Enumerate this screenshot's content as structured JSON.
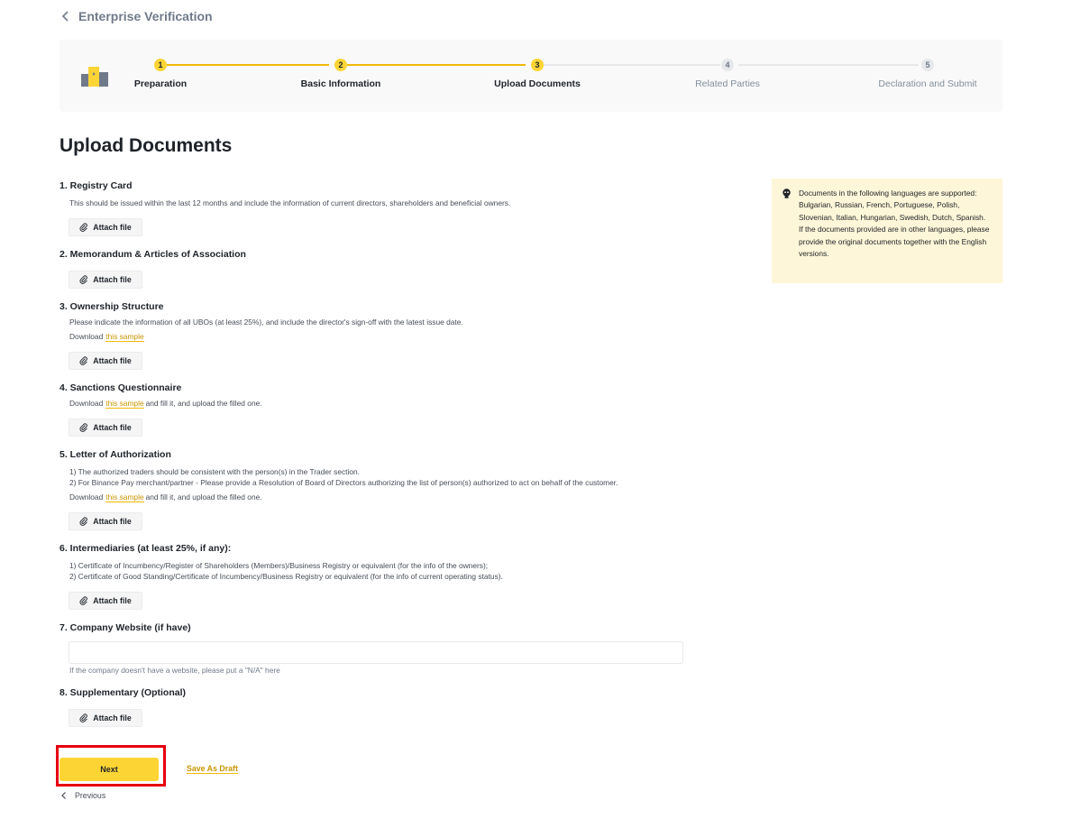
{
  "header": {
    "title": "Enterprise Verification"
  },
  "stepper": {
    "steps": [
      {
        "number": "1",
        "label": "Preparation"
      },
      {
        "number": "2",
        "label": "Basic Information"
      },
      {
        "number": "3",
        "label": "Upload Documents"
      },
      {
        "number": "4",
        "label": "Related Parties"
      },
      {
        "number": "5",
        "label": "Declaration and Submit"
      }
    ],
    "current_step": 3
  },
  "main": {
    "title": "Upload Documents",
    "attach_label": "Attach file",
    "download_label": "Download",
    "sample_link": "this sample",
    "fill_suffix": "and fill it, and upload the filled one.",
    "sections": [
      {
        "title": "1. Registry Card",
        "desc": [
          "This should be issued within the last 12 months and include the information of current directors, shareholders and beneficial owners."
        ]
      },
      {
        "title": "2. Memorandum & Articles of Association"
      },
      {
        "title": "3. Ownership Structure",
        "desc": [
          "Please indicate the information of all UBOs (at least 25%), and include the director's sign-off with the latest issue date."
        ]
      },
      {
        "title": "4. Sanctions Questionnaire"
      },
      {
        "title": "5. Letter of Authorization",
        "desc": [
          "1) The authorized traders should be consistent with the person(s) in the Trader section.",
          "2) For Binance Pay merchant/partner - Please provide a Resolution of Board of Directors authorizing the list of person(s) authorized to act on behalf of the customer."
        ]
      },
      {
        "title": "6. Intermediaries (at least 25%, if any):",
        "desc": [
          "1) Certificate of Incumbency/Register of Shareholders (Members)/Business Registry or equivalent (for the info of the owners);",
          "2) Certificate of Good Standing/Certificate of Incumbency/Business Registry or equivalent (for the info of current operating status)."
        ]
      },
      {
        "title": "7. Company Website (if have)",
        "value": "",
        "hint": "If the company doesn't have a website, please put a \"N/A\" here"
      },
      {
        "title": "8. Supplementary (Optional)"
      }
    ]
  },
  "notice": {
    "text": "Documents in the following languages are supported: Bulgarian, Russian, French, Portuguese, Polish, Slovenian, Italian, Hungarian, Swedish, Dutch, Spanish. If the documents provided are in other languages, please provide the original documents together with the English versions."
  },
  "footer": {
    "next_label": "Next",
    "draft_label": "Save As Draft",
    "previous_label": "Previous"
  },
  "colors": {
    "brand_yellow": "#fcd535",
    "link_gold": "#c99400",
    "highlight_red": "#e6000f",
    "notice_bg": "#fef6d8"
  }
}
